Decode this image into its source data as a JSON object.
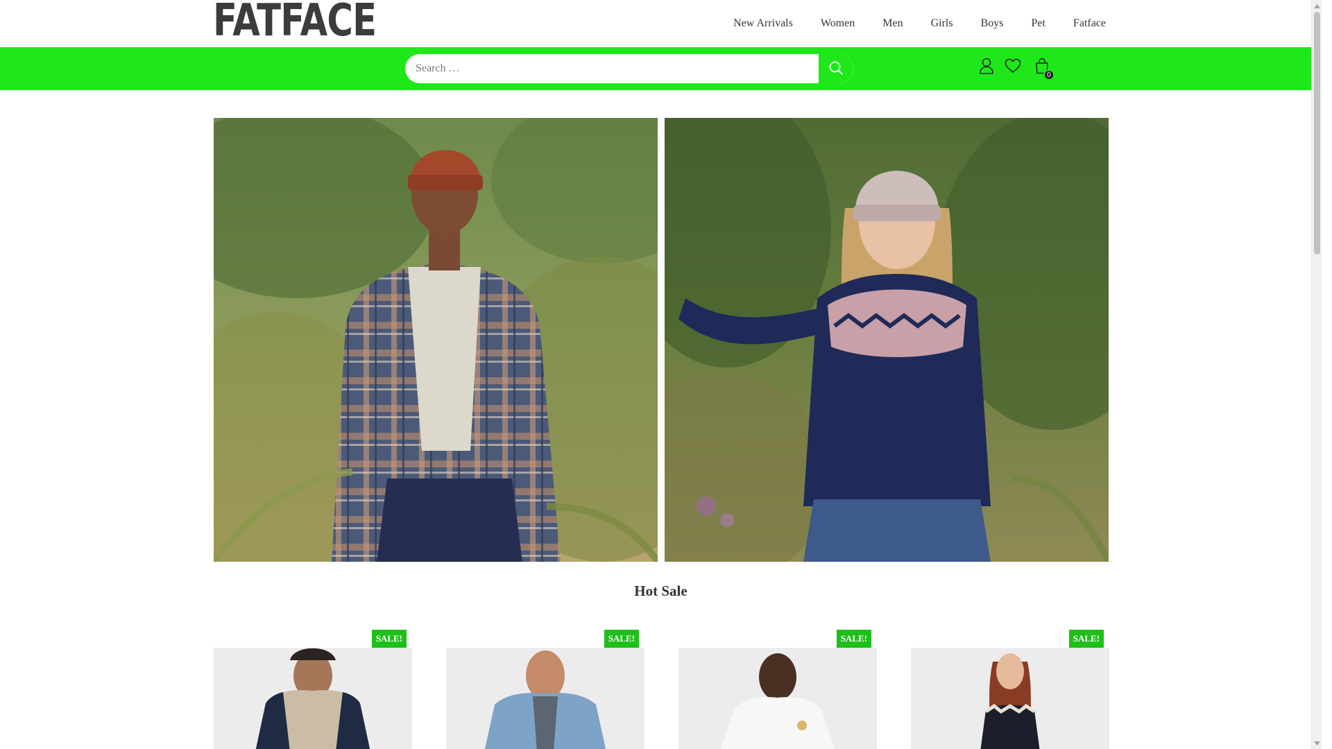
{
  "brand": {
    "logo_text": "FATFACE"
  },
  "nav": {
    "items": [
      {
        "label": "New Arrivals"
      },
      {
        "label": "Women"
      },
      {
        "label": "Men"
      },
      {
        "label": "Girls"
      },
      {
        "label": "Boys"
      },
      {
        "label": "Pet"
      },
      {
        "label": "Fatface"
      }
    ]
  },
  "search": {
    "placeholder": "Search …",
    "value": ""
  },
  "header_icons": {
    "account": "user-icon",
    "wishlist": "heart-icon",
    "cart": "shopping-bag-icon",
    "cart_count": "0"
  },
  "banners": [
    {
      "alt": "man-plaid-shirt-beanie-fern-field",
      "icon": "hero-image"
    },
    {
      "alt": "woman-fair-isle-sweater-beanie-fern-field",
      "icon": "hero-image"
    }
  ],
  "hot_sale": {
    "title": "Hot Sale",
    "products": [
      {
        "badge": "SALE!",
        "image": "man-hoodie"
      },
      {
        "badge": "SALE!",
        "image": "man-denim-shirt"
      },
      {
        "badge": "SALE!",
        "image": "man-white-tshirt"
      },
      {
        "badge": "SALE!",
        "image": "woman-black-dress"
      }
    ]
  },
  "colors": {
    "accent_green": "#1fe81a",
    "badge_green": "#1fbf1a",
    "text": "#333333"
  }
}
